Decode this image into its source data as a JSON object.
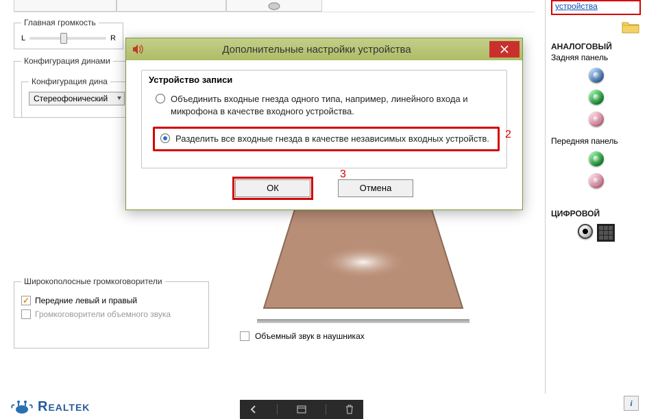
{
  "top_link": "устройства",
  "main": {
    "master_volume_legend": "Главная громкость",
    "L": "L",
    "R": "R",
    "speaker_config_legend": "Конфигурация динами",
    "speaker_config_inner_legend": "Конфигурация дина",
    "speaker_mode": "Стереофонический",
    "wideband_legend": "Широкополосные громкоговорители",
    "front_lr": "Передние левый и правый",
    "surround": "Громкоговорители объемного звука",
    "headphone_surround": "Объемный звук в наушниках"
  },
  "right": {
    "analog": "АНАЛОГОВЫЙ",
    "rear_panel": "Задняя панель",
    "front_panel": "Передняя панель",
    "digital": "ЦИФРОВОЙ"
  },
  "dialog": {
    "title": "Дополнительные настройки устройства",
    "group_title": "Устройство записи",
    "opt1": "Объединить входные гнезда одного типа, например, линейного входа и микрофона в качестве входного устройства.",
    "opt2": "Разделить все входные гнезда в качестве независимых входных устройств.",
    "ok": "ОК",
    "cancel": "Отмена"
  },
  "annotations": {
    "n2": "2",
    "n3": "3"
  },
  "brand": "Realtek",
  "info": "i"
}
